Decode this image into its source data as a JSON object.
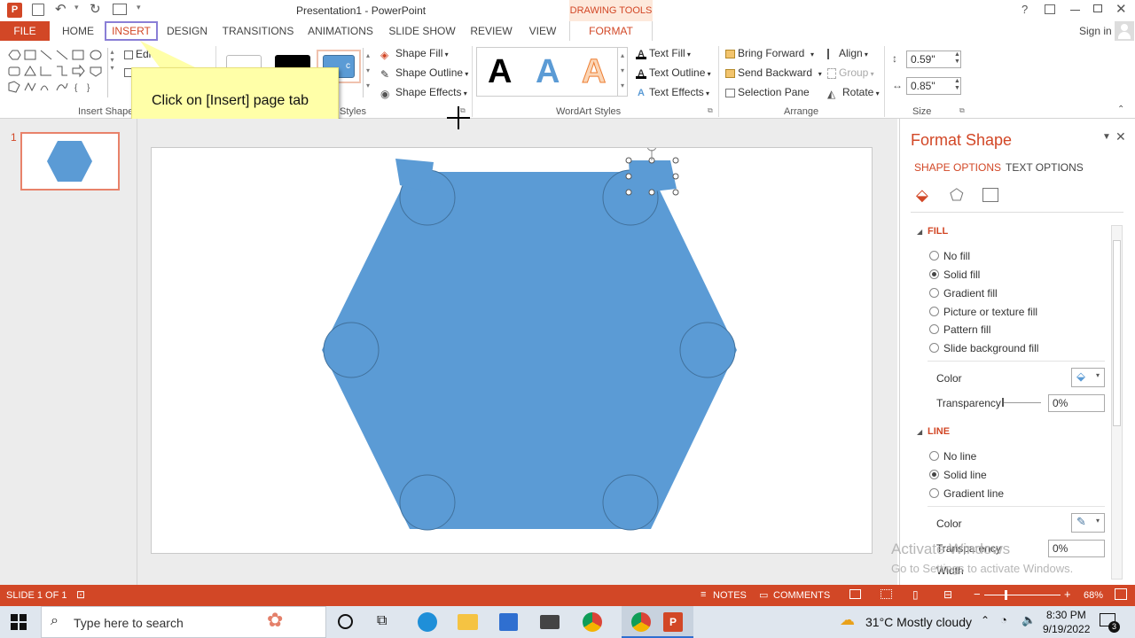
{
  "window": {
    "title": "Presentation1 - PowerPoint",
    "contextual_group": "DRAWING TOOLS",
    "help": "?",
    "sign_in": "Sign in"
  },
  "tabs": [
    "FILE",
    "HOME",
    "INSERT",
    "DESIGN",
    "TRANSITIONS",
    "ANIMATIONS",
    "SLIDE SHOW",
    "REVIEW",
    "VIEW",
    "FORMAT"
  ],
  "ribbon": {
    "insert_shapes": {
      "edit_shape": "Edit",
      "label": "Insert Shape"
    },
    "shape_styles": {
      "label": "Styles",
      "sample_text": "c",
      "shape_fill": "Shape Fill",
      "shape_outline": "Shape Outline",
      "shape_effects": "Shape Effects"
    },
    "wordart": {
      "label": "WordArt Styles",
      "sample": "A",
      "text_fill": "Text Fill",
      "text_outline": "Text Outline",
      "text_effects": "Text Effects"
    },
    "arrange": {
      "label": "Arrange",
      "bring_forward": "Bring Forward",
      "send_backward": "Send Backward",
      "selection_pane": "Selection Pane",
      "align": "Align",
      "group": "Group",
      "rotate": "Rotate"
    },
    "size": {
      "label": "Size",
      "height": "0.59\"",
      "width": "0.85\""
    }
  },
  "callout": {
    "text": "Click on [Insert] page tab"
  },
  "thumbnails": {
    "slide_number": "1"
  },
  "format_pane": {
    "title": "Format Shape",
    "tab_shape_options": "SHAPE OPTIONS",
    "tab_text_options": "TEXT OPTIONS",
    "fill_header": "FILL",
    "fill_options": [
      "No fill",
      "Solid fill",
      "Gradient fill",
      "Picture or texture fill",
      "Pattern fill",
      "Slide background fill"
    ],
    "fill_selected": "Solid fill",
    "fill_color_label": "Color",
    "fill_transparency_label": "Transparency",
    "fill_transparency_value": "0%",
    "line_header": "LINE",
    "line_options": [
      "No line",
      "Solid line",
      "Gradient line"
    ],
    "line_selected": "Solid line",
    "line_color_label": "Color",
    "line_transparency_label": "Transparency",
    "line_transparency_value": "0%",
    "line_width_label": "Width"
  },
  "watermark": {
    "line1": "Activate Windows",
    "line2": "Go to Settings to activate Windows."
  },
  "status": {
    "slide": "SLIDE 1 OF 1",
    "notes": "NOTES",
    "comments": "COMMENTS",
    "zoom": "68%"
  },
  "taskbar": {
    "search_placeholder": "Type here to search",
    "weather": "31°C  Mostly cloudy",
    "time": "8:30 PM",
    "date": "9/19/2022",
    "notification_count": "3"
  },
  "colors": {
    "accent": "#d24726",
    "shape": "#5b9bd5",
    "shape_outline": "#41719c",
    "contextual": "#d24726"
  }
}
